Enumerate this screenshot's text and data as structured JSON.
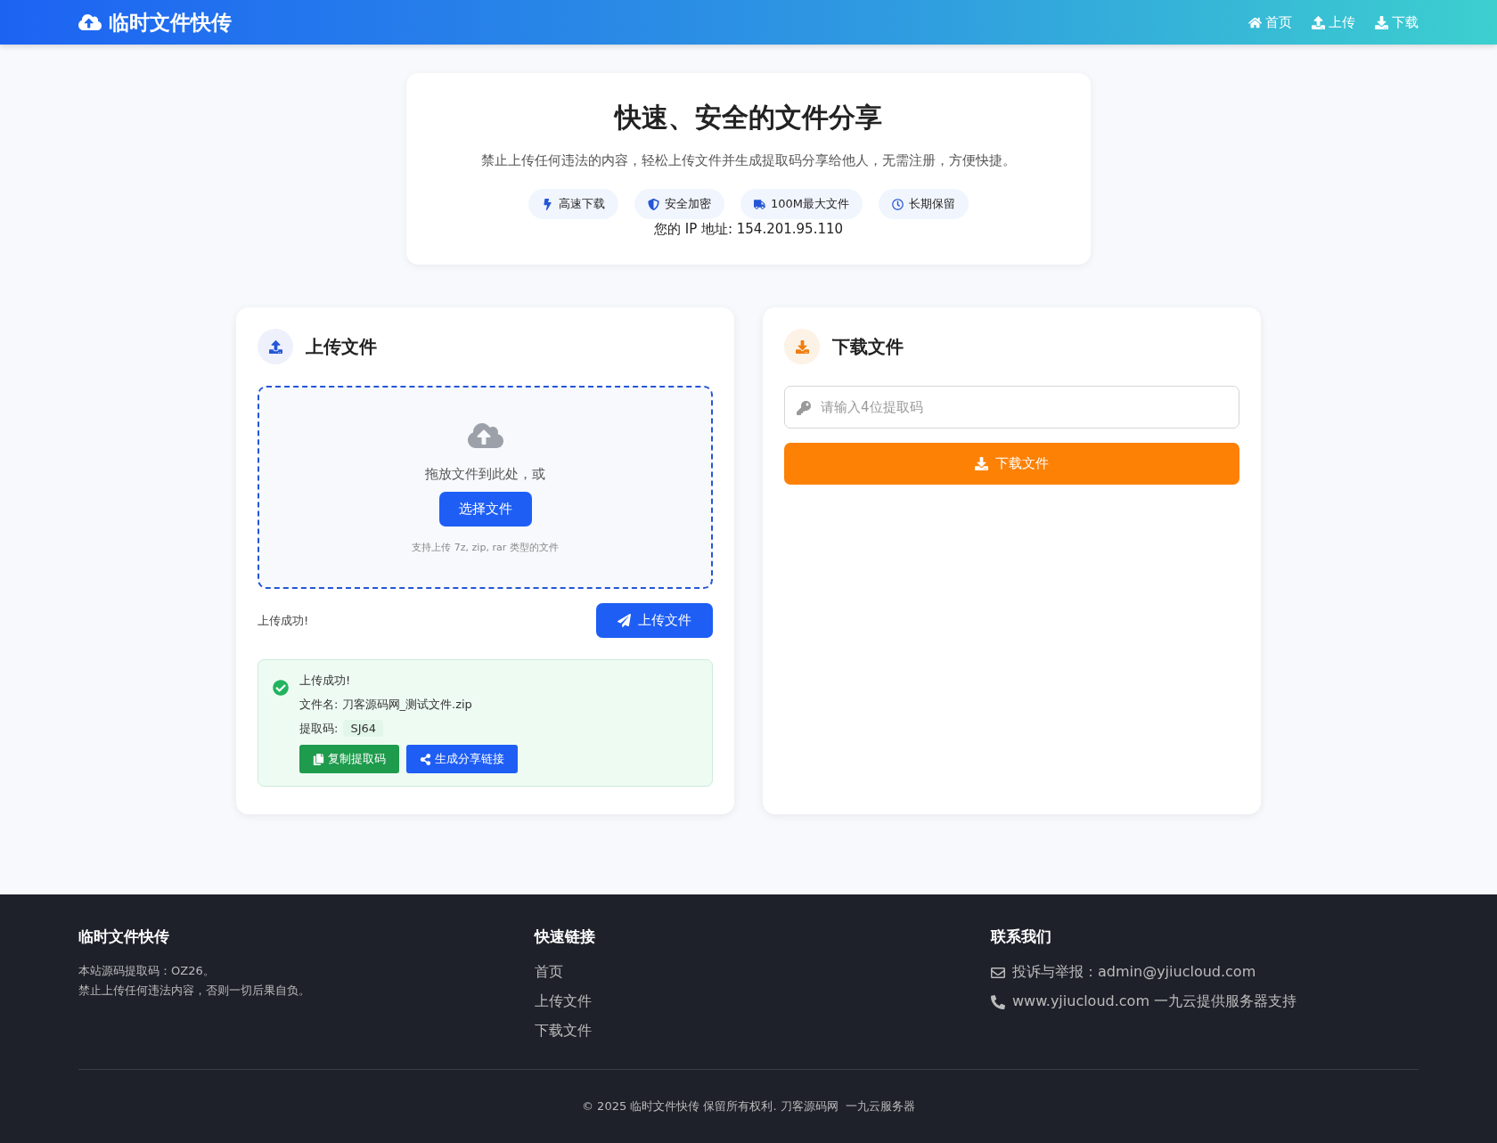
{
  "header": {
    "logo": "临时文件快传",
    "nav": [
      {
        "kind": "home",
        "label": "首页"
      },
      {
        "kind": "upload",
        "label": "上传"
      },
      {
        "kind": "download",
        "label": "下载"
      }
    ]
  },
  "hero": {
    "title": "快速、安全的文件分享",
    "subtitle": "禁止上传任何违法的内容，轻松上传文件并生成提取码分享给他人，无需注册，方便快捷。",
    "features": [
      {
        "kind": "bolt",
        "label": "高速下载"
      },
      {
        "kind": "shield",
        "label": "安全加密"
      },
      {
        "kind": "truck",
        "label": "100M最大文件"
      },
      {
        "kind": "clock",
        "label": "长期保留"
      }
    ],
    "ip": "您的 IP 地址: 154.201.95.110"
  },
  "upload": {
    "title": "上传文件",
    "drop_text": "拖放文件到此处，或",
    "choose_button": "选择文件",
    "hint": "支持上传 7z, zip, rar 类型的文件",
    "status": "上传成功!",
    "upload_button": "上传文件",
    "result": {
      "title": "上传成功!",
      "filename": "文件名: 刀客源码网_测试文件.zip",
      "code_label": "提取码:",
      "code": "SJ64",
      "copy_button": "复制提取码",
      "share_button": "生成分享链接"
    }
  },
  "download": {
    "title": "下载文件",
    "placeholder": "请输入4位提取码",
    "button": "下载文件"
  },
  "footer": {
    "columns": [
      {
        "kind": "text",
        "title": "临时文件快传",
        "lines": [
          "本站源码提取码：OZ26。",
          "禁止上传任何违法内容，否则一切后果自负。"
        ]
      },
      {
        "kind": "links",
        "title": "快速链接",
        "lines": [
          "首页",
          "上传文件",
          "下载文件"
        ]
      },
      {
        "kind": "contact",
        "title": "联系我们",
        "lines": [
          "投诉与举报：admin@yjiucloud.com",
          "www.yjiucloud.com 一九云提供服务器支持"
        ]
      }
    ],
    "copyright": "© 2025 临时文件快传 保留所有权利. 刀客源码网  一九云服务器"
  }
}
